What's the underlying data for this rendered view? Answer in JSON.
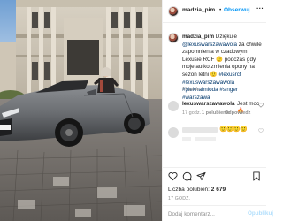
{
  "post": {
    "username": "madzia_pim",
    "separator": "•",
    "follow_label": "Obserwuj",
    "more_label": "···"
  },
  "caption": {
    "username": "madzia_pim",
    "text_before": " Dziękuje ",
    "mention": "@lexuswarszawawola",
    "text_middle": " za chwile zapomnienia w czadowym Lexusie RCF 🙂 podczas gdy moje autko zmienia opony na sezon letni 🙂 ",
    "hashtags": "#lexusrcf #lexuswarszawawola #pieknaimloda #singer #warszawa",
    "time": "17 godz."
  },
  "comment": {
    "username": "lexuswarszawawola",
    "text": "Jest moc🔥",
    "time": "17 godz.",
    "likes": "1 polubienie",
    "reply": "Odpowiedz"
  },
  "comment2": {
    "emoji": "🙂🙂🙂🙂"
  },
  "stats": {
    "likes_label": "Liczba polubień: ",
    "likes_value": "2 679",
    "date": "17 GODZ."
  },
  "add_comment": {
    "placeholder": "Dodaj komentarz...",
    "post_label": "Opublikuj"
  },
  "colors": {
    "accent": "#0095f6",
    "post_disabled": "#b2dffc",
    "car_paint": "#6e7073",
    "sky": "#8fb6de"
  },
  "icons": [
    "heart-icon",
    "comment-icon",
    "share-icon",
    "bookmark-icon",
    "more-icon"
  ]
}
